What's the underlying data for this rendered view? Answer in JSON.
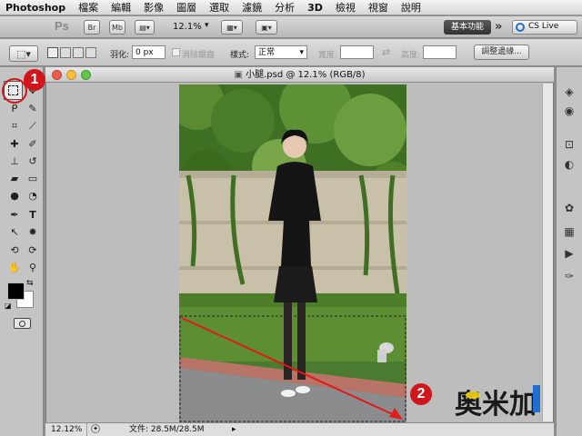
{
  "menubar": {
    "app": "Photoshop",
    "items": [
      "檔案",
      "編輯",
      "影像",
      "圖層",
      "選取",
      "濾鏡",
      "分析",
      "3D",
      "檢視",
      "視窗",
      "說明"
    ]
  },
  "appbar": {
    "logo": "Ps",
    "bridge": "Br",
    "minibridge": "Mb",
    "zoom": "12.1%",
    "workspace": "基本功能",
    "more": "»",
    "cslive": "CS Live"
  },
  "options": {
    "feather_label": "羽化:",
    "feather_value": "0 px",
    "antialias_label": "消除鋸齒",
    "style_label": "樣式:",
    "style_value": "正常",
    "width_label": "寬度:",
    "height_label": "高度:",
    "refine_edge": "調整邊緣..."
  },
  "document": {
    "title": "小腿.psd @ 12.1% (RGB/8)"
  },
  "status": {
    "zoom": "12.12%",
    "file_info": "文件: 28.5M/28.5M"
  },
  "annotations": {
    "badge1": "1",
    "badge2": "2"
  },
  "watermark": "奧米加",
  "colors": {
    "badge": "#d0161c",
    "arrow": "#e11a1a",
    "accent_blue": "#1f6fd1"
  }
}
